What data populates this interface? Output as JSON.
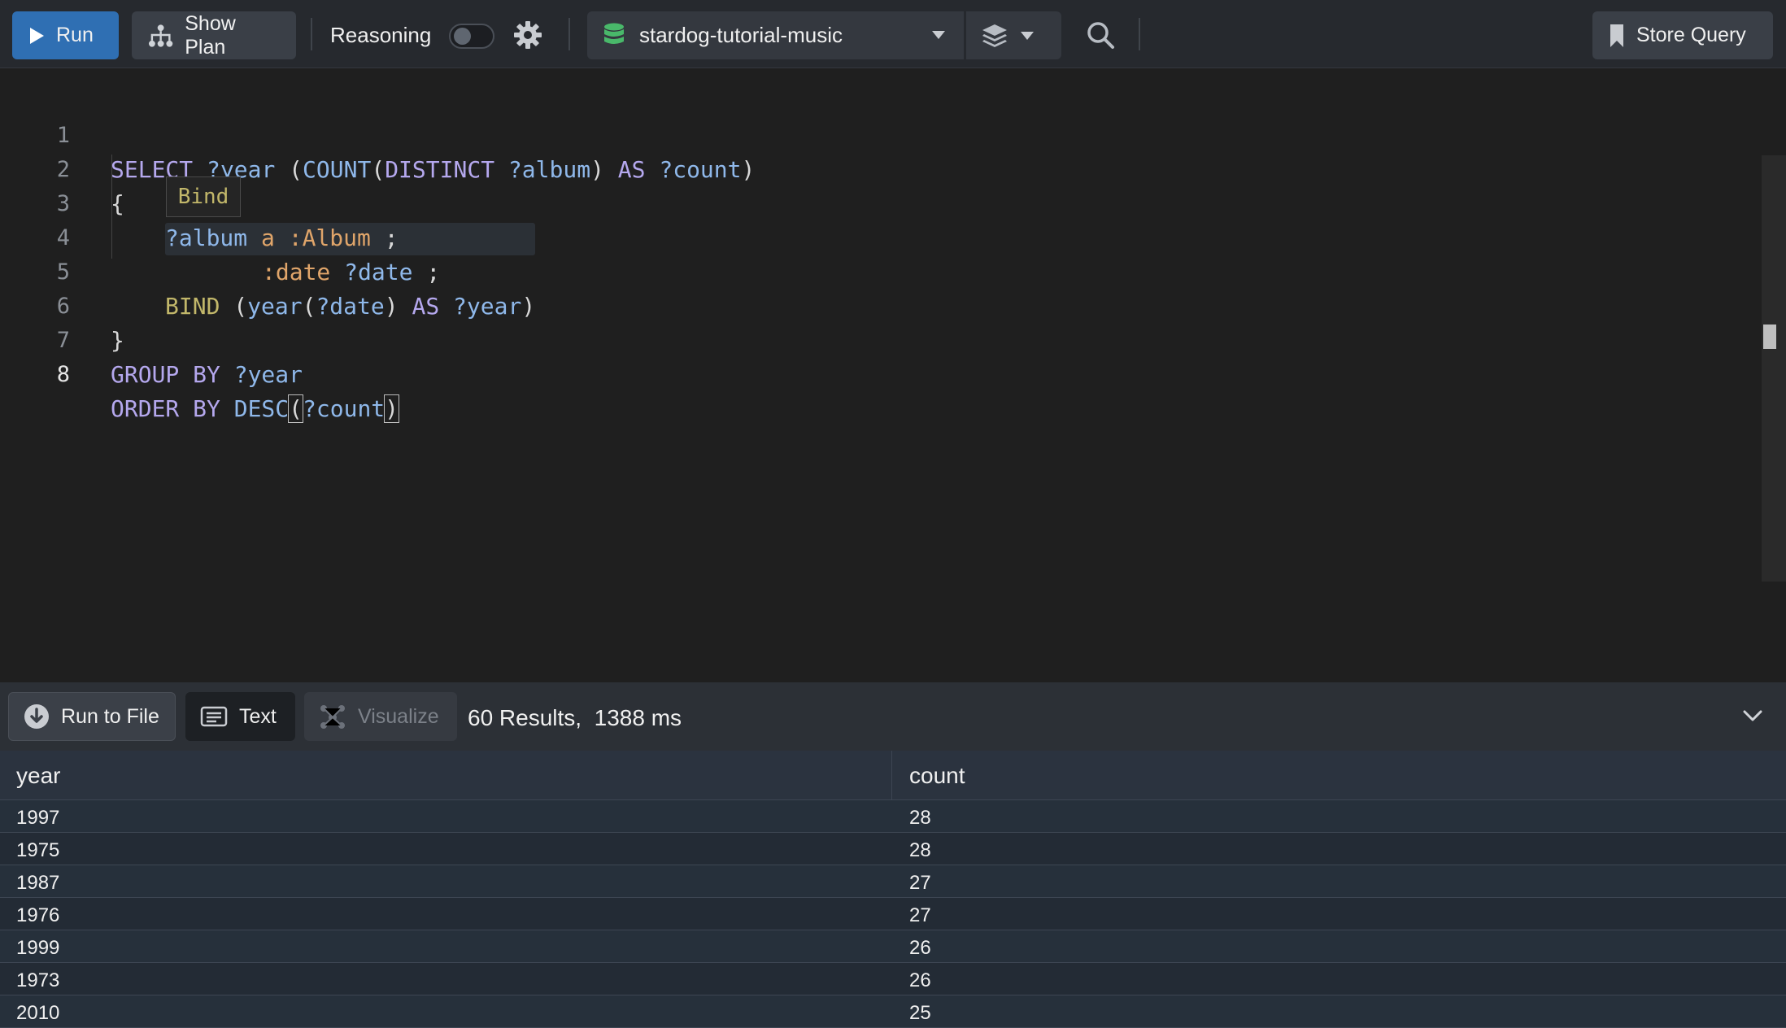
{
  "toolbar": {
    "run_label": "Run",
    "show_plan_label": "Show Plan",
    "reasoning_label": "Reasoning",
    "reasoning_enabled": false,
    "database": "stardog-tutorial-music",
    "store_query_label": "Store Query"
  },
  "editor": {
    "lines": [
      {
        "num": "1"
      },
      {
        "num": "2",
        "text": "{"
      },
      {
        "num": "3"
      },
      {
        "num": "4"
      },
      {
        "num": "5"
      },
      {
        "num": "6",
        "text": "}"
      },
      {
        "num": "7"
      },
      {
        "num": "8"
      }
    ],
    "tokens": {
      "select": "SELECT",
      "year_var": "?year",
      "paren_open": "(",
      "count_fn": "COUNT",
      "distinct": "DISTINCT",
      "album_var": "?album",
      "paren_close": ")",
      "as": "AS",
      "count_var": "?count",
      "a_kw": "a",
      "album_class": ":Album",
      "semicolon": ";",
      "date_prop": ":date",
      "date_var": "?date",
      "bind": "BIND",
      "year_fn": "year",
      "group_by": "GROUP BY",
      "order_by": "ORDER BY",
      "desc": "DESC"
    },
    "tooltip": "Bind"
  },
  "results": {
    "run_to_file_label": "Run to File",
    "text_label": "Text",
    "visualize_label": "Visualize",
    "count_text": "60 Results,",
    "time_text": "1388 ms",
    "columns": [
      "year",
      "count"
    ],
    "rows": [
      [
        "1997",
        "28"
      ],
      [
        "1975",
        "28"
      ],
      [
        "1987",
        "27"
      ],
      [
        "1976",
        "27"
      ],
      [
        "1999",
        "26"
      ],
      [
        "1973",
        "26"
      ],
      [
        "2010",
        "25"
      ]
    ]
  },
  "colors": {
    "run_button": "#2f6fb3",
    "database_icon": "#49b86a",
    "keyword": "#b5a8ee",
    "variable": "#8fb8ea",
    "class": "#e0a56a"
  },
  "icons": {
    "run": "play-icon",
    "show_plan": "tree-icon",
    "reasoning_settings": "gear-icon",
    "database": "database-icon",
    "namespaces": "layers-icon",
    "search": "search-icon",
    "store_query": "bookmark-icon",
    "run_to_file": "download-icon",
    "text": "text-format-icon",
    "visualize": "visualize-icon",
    "collapse": "chevron-down-icon"
  }
}
